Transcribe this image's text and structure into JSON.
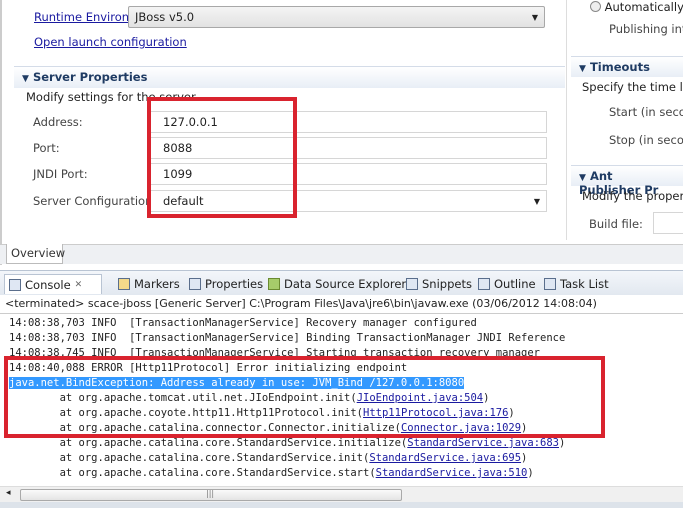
{
  "editor": {
    "runtime_label": "Runtime Environment:",
    "runtime_value": "JBoss v5.0",
    "open_launch": "Open launch configuration",
    "server_properties": {
      "title": "Server Properties",
      "desc": "Modify settings for the server.",
      "address_label": "Address:",
      "address": "127.0.0.1",
      "port_label": "Port:",
      "port": "8088",
      "jndi_label": "JNDI Port:",
      "jndi": "1099",
      "config_label": "Server Configuration:",
      "config": "default"
    },
    "right": {
      "automatically": "Automatically",
      "publishing": "Publishing int",
      "timeouts": "Timeouts",
      "timeouts_desc": "Specify the time lin",
      "start": "Start (in secon",
      "stop": "Stop (in secon",
      "ant": "Ant Publisher Pr",
      "ant_desc": "Modify the propert",
      "build_file": "Build file:"
    },
    "overview_tab": "Overview"
  },
  "views": {
    "tabs": [
      "Console",
      "Markers",
      "Properties",
      "Data Source Explorer",
      "Snippets",
      "Outline",
      "Task List"
    ],
    "close": "✕"
  },
  "console": {
    "header": "<terminated> scace-jboss [Generic Server] C:\\Program Files\\Java\\jre6\\bin\\javaw.exe (03/06/2012 14:08:04)",
    "lines": [
      "14:08:38,703 INFO  [TransactionManagerService] Recovery manager configured",
      "14:08:38,703 INFO  [TransactionManagerService] Binding TransactionManager JNDI Reference",
      "14:08:38,745 INFO  [TransactionManagerService] Starting transaction recovery manager",
      "14:08:40,088 ERROR [Http11Protocol] Error initializing endpoint",
      "java.net.BindException: Address already in use: JVM_Bind /127.0.0.1:8080"
    ],
    "trace": [
      {
        "pre": "        at org.apache.tomcat.util.net.JIoEndpoint.init(",
        "link": "JIoEndpoint.java:504"
      },
      {
        "pre": "        at org.apache.coyote.http11.Http11Protocol.init(",
        "link": "Http11Protocol.java:176"
      },
      {
        "pre": "        at org.apache.catalina.connector.Connector.initialize(",
        "link": "Connector.java:1029"
      },
      {
        "pre": "        at org.apache.catalina.core.StandardService.initialize(",
        "link": "StandardService.java:683"
      },
      {
        "pre": "        at org.apache.catalina.core.StandardService.init(",
        "link": "StandardService.java:695"
      },
      {
        "pre": "        at org.apache.catalina.core.StandardService.start(",
        "link": "StandardService.java:510"
      }
    ]
  },
  "colors": {
    "highlight": "#d9232e",
    "selection": "#3399ff"
  }
}
